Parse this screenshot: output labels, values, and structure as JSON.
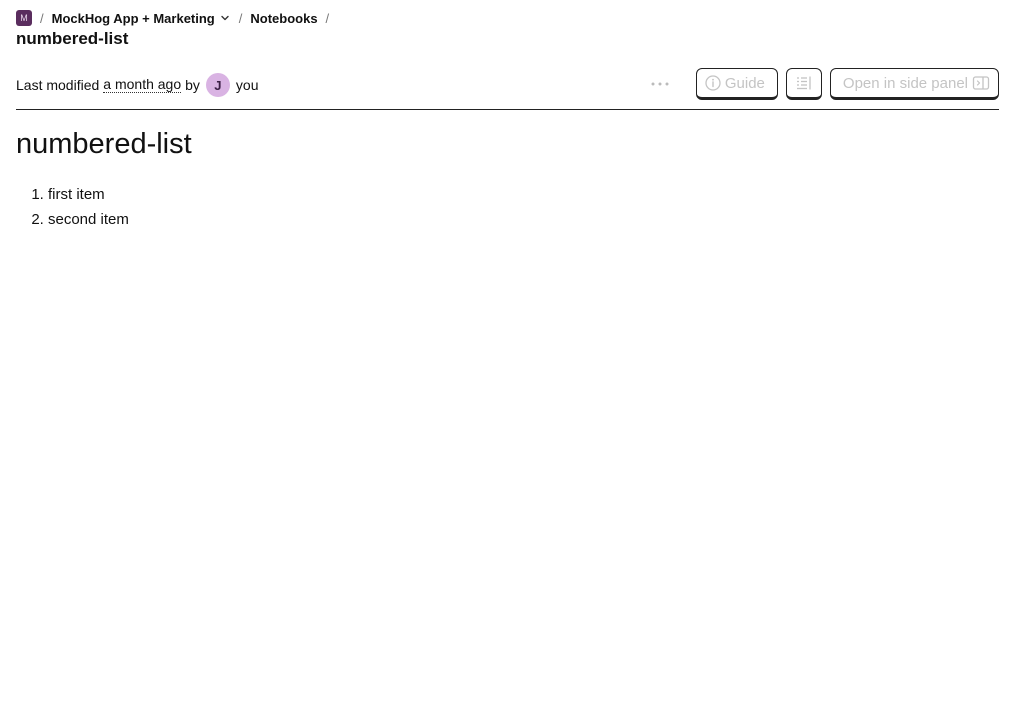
{
  "breadcrumb": {
    "project_badge": "M",
    "project_name": "MockHog App + Marketing",
    "section": "Notebooks",
    "separator": "/",
    "icons": {
      "chevron": "chevron-down-icon"
    }
  },
  "header": {
    "title": "numbered-list"
  },
  "meta": {
    "prefix": "Last modified",
    "relative_time": "a month ago",
    "by": "by",
    "avatar_initial": "J",
    "author": "you",
    "avatar_color": "#d9b3e3"
  },
  "toolbar": {
    "more_label": "⋯",
    "guide_label": "Guide",
    "open_side_panel_label": "Open in side panel",
    "icons": {
      "more": "more-horizontal-icon",
      "guide": "info-icon",
      "toc": "table-of-contents-icon",
      "side_panel": "side-panel-icon"
    }
  },
  "notebook": {
    "heading": "numbered-list",
    "list_items": [
      "first item",
      "second item"
    ]
  },
  "colors": {
    "project_badge_bg": "#5a2d5e",
    "disabled_text": "#c4c4c4",
    "border": "#222222"
  }
}
